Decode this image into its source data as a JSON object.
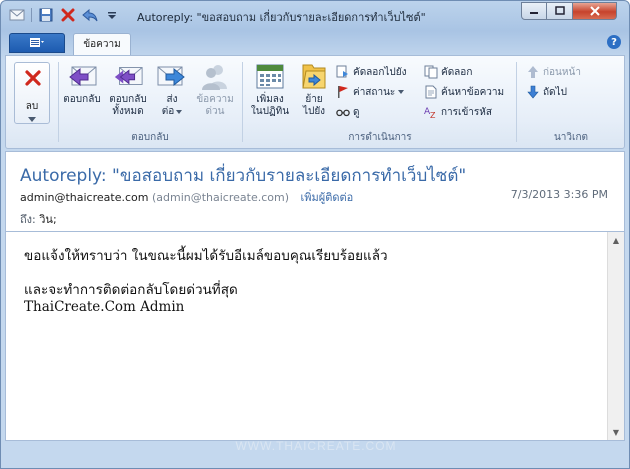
{
  "window": {
    "title": "Autoreply: \"ขอสอบถาม เกี่ยวกับรายละเอียดการทำเว็บไซต์\"",
    "controls": [
      "minimize",
      "maximize",
      "close"
    ]
  },
  "quick_access": [
    "save-icon",
    "delete-icon",
    "reply-icon",
    "customize-icon"
  ],
  "tabs": {
    "file_icon": "file-menu-icon",
    "active": "ข้อความ",
    "help": "?"
  },
  "ribbon": {
    "delete": {
      "label": "ลบ"
    },
    "respond": {
      "group_label": "ตอบกลับ",
      "reply": "ตอบกลับ",
      "reply_all_1": "ตอบกลับ",
      "reply_all_2": "ทั้งหมด",
      "forward_1": "ส่ง",
      "forward_2": "ต่อ",
      "im_1": "ข้อความ",
      "im_2": "ด่วน"
    },
    "actions": {
      "group_label": "การดำเนินการ",
      "calendar_1": "เพิ่มลง",
      "calendar_2": "ในปฏิทิน",
      "move_1": "ย้าย",
      "move_2": "ไปยัง",
      "copy_to": "คัดลอกไปยัง",
      "flag": "ค่าสถานะ",
      "view": "ดู",
      "copy": "คัดลอก",
      "find": "ค้นหาข้อความ",
      "encoding": "การเข้ารหัส"
    },
    "navigate": {
      "group_label": "นาวิเกต",
      "previous": "ก่อนหน้า",
      "next": "ถัดไป"
    }
  },
  "message": {
    "subject": "Autoreply: \"ขอสอบถาม เกี่ยวกับรายละเอียดการทำเว็บไซต์\"",
    "sender_email": "admin@thaicreate.com",
    "sender_paren": "(admin@thaicreate.com)",
    "add_contact": "เพิ่มผู้ติดต่อ",
    "date": "7/3/2013 3:36 PM",
    "to_label": "ถึง:",
    "to_value": "วิน;",
    "body": {
      "line1": "ขอแจ้งให้ทราบว่า ในขณะนี้ผมได้รับอีเมล์ขอบคุณเรียบร้อยแล้ว",
      "line2": "",
      "line3": "และจะทำการติดต่อกลับโดยด่วนที่สุด",
      "line4": "ThaiCreate.Com Admin"
    }
  },
  "watermark": "WWW.THAICREATE.COM"
}
